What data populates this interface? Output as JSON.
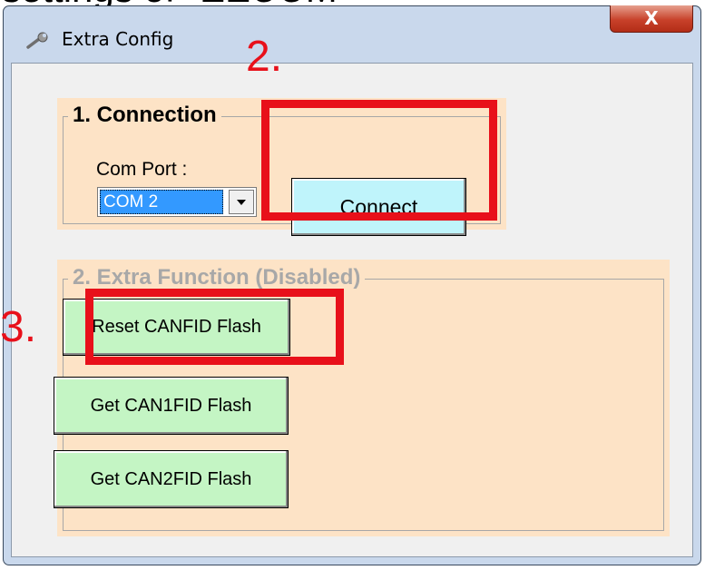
{
  "clipped_caption": "settings of \"EEUUM\"",
  "window": {
    "title": "Extra Config",
    "close_label": "X",
    "title_icon": "wrench-icon"
  },
  "connection_group": {
    "legend": "1. Connection",
    "com_port_label": "Com Port :",
    "com_port_value": "COM 2",
    "connect_label": "Connect"
  },
  "extra_group": {
    "legend": "2. Extra Function (Disabled)",
    "buttons": [
      {
        "label": "Reset CANFID Flash"
      },
      {
        "label": "Get CAN1FID Flash"
      },
      {
        "label": "Get CAN2FID Flash"
      }
    ]
  },
  "annotations": {
    "step2": "2.",
    "step3": "3.",
    "color": "#e8101a"
  },
  "colors": {
    "group_bg": "#fde3c6",
    "connect_bg": "#bff4fb",
    "green_button_bg": "#c4f5c4",
    "selected_bg": "#3399ff",
    "close_red": "#c8412a"
  }
}
